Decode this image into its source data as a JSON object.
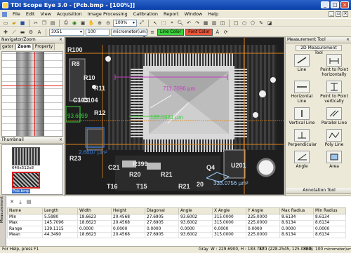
{
  "app": {
    "title": "TDI Scope Eye 3.0 - [Pcb.bmp - [100%]]"
  },
  "menu": [
    "File",
    "Edit",
    "View",
    "Acquisition",
    "Image Processing",
    "Calibration",
    "Report",
    "Window",
    "Help"
  ],
  "toolbar2": {
    "zoom_value": "100%",
    "size_select": "3X51",
    "size_value": "100",
    "unit_select": "micrometer(um)",
    "line_color_label": "Line Color",
    "font_color_label": "Font Color"
  },
  "navigator": {
    "header": "Navigator/Zoom",
    "tabs": [
      "gator",
      "Zoom",
      "Property"
    ],
    "thumbnail_header": "Thumbnail",
    "thumbnails": [
      "640x512x8",
      "Pcb.bmp"
    ]
  },
  "right_panel": {
    "header": "Measurement Tool",
    "subheader": "2D Measurement Tool",
    "tools": [
      "Line",
      "Point to Point horizontally",
      "Horizontal Line",
      "Point to Point vertically",
      "Vertical Line",
      "Parallel Line",
      "Perpendicular",
      "Poly Line",
      "Angle",
      "Area"
    ],
    "footer_header": "Annotation Tool"
  },
  "annotations": [
    {
      "text": "711.7096 µm",
      "color": "#c93cc9"
    },
    {
      "text": "126.6981 µm",
      "color": "#3bd13b"
    },
    {
      "text": "93.6099",
      "color": "#3bd13b"
    },
    {
      "text": "2.6607 µm²",
      "color": "#3b7fe0"
    },
    {
      "text": "333.0756 µm²",
      "color": "#9fd0ff"
    }
  ],
  "board_labels": [
    "R100",
    "R8",
    "R10",
    "R11",
    "R12",
    "C103",
    "C104",
    "R23",
    "C21",
    "R20",
    "R399",
    "R21",
    "U201",
    "Q4",
    "20",
    "T16",
    "T15",
    "R21"
  ],
  "measurement": {
    "side_label": "Measurement",
    "columns": [
      "Name",
      "Length",
      "Width",
      "Height",
      "Diagonal",
      "Angle",
      "X Angle",
      "Y Angle",
      "Max Radius",
      "Min Radius"
    ],
    "rows": [
      [
        "Min",
        "5.5980",
        "18.6623",
        "20.4568",
        "27.6905",
        "93.6002",
        "315.0000",
        "225.0000",
        "8.6134",
        "8.6134"
      ],
      [
        "Max",
        "145.7096",
        "18.6623",
        "20.4568",
        "27.6905",
        "93.6002",
        "315.0000",
        "225.0000",
        "8.6134",
        "8.6134"
      ],
      [
        "Range",
        "139.1115",
        "0.0000",
        "0.0000",
        "0.0000",
        "0.0000",
        "0.0000",
        "0.0000",
        "0.0000",
        "0.0000"
      ],
      [
        "Mean",
        "44.3490",
        "18.6623",
        "20.4568",
        "27.6905",
        "93.6002",
        "315.0000",
        "225.0000",
        "8.6134",
        "8.6134"
      ]
    ]
  },
  "status": {
    "help": "For Help, press F1",
    "mode": "Gray",
    "coords": "W : 229.6900, H : 183.7520",
    "xy": "XY : (228.2545, 125.0300)",
    "bits": "8BIS",
    "zoom": "100",
    "unit": "micrometer(um)"
  },
  "colors": {
    "title_bar": "#0a3ea8",
    "line_color": "#3bd13b",
    "font_color": "#e8563a",
    "guide_orange": "#e0841a"
  }
}
